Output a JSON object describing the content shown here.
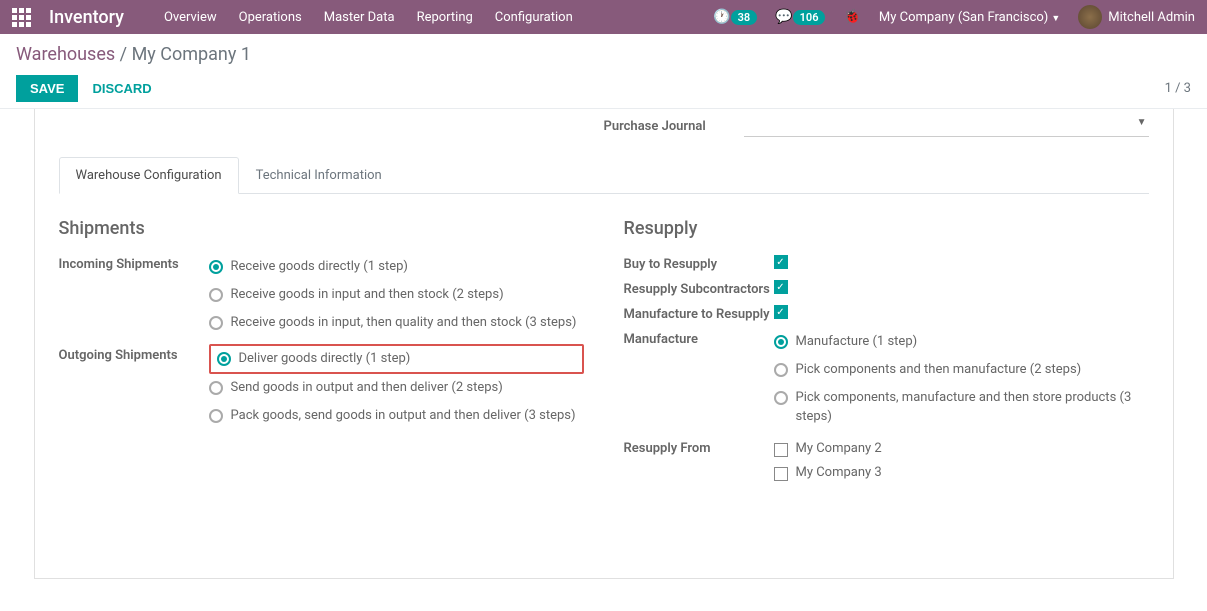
{
  "topbar": {
    "brand": "Inventory",
    "menu": [
      "Overview",
      "Operations",
      "Master Data",
      "Reporting",
      "Configuration"
    ],
    "badge1": "38",
    "badge2": "106",
    "company": "My Company (San Francisco)",
    "user": "Mitchell Admin"
  },
  "breadcrumb": {
    "root": "Warehouses",
    "current": "My Company 1"
  },
  "actions": {
    "save": "SAVE",
    "discard": "DISCARD"
  },
  "pager": "1 / 3",
  "fields": {
    "purchase_journal": "Purchase Journal"
  },
  "tabs": {
    "config": "Warehouse Configuration",
    "tech": "Technical Information"
  },
  "shipments": {
    "title": "Shipments",
    "incoming_label": "Incoming Shipments",
    "incoming": [
      "Receive goods directly (1 step)",
      "Receive goods in input and then stock (2 steps)",
      "Receive goods in input, then quality and then stock (3 steps)"
    ],
    "outgoing_label": "Outgoing Shipments",
    "outgoing": [
      "Deliver goods directly (1 step)",
      "Send goods in output and then deliver (2 steps)",
      "Pack goods, send goods in output and then deliver (3 steps)"
    ]
  },
  "resupply": {
    "title": "Resupply",
    "buy": "Buy to Resupply",
    "subcon": "Resupply Subcontractors",
    "mfg_to": "Manufacture to Resupply",
    "mfg_label": "Manufacture",
    "mfg": [
      "Manufacture (1 step)",
      "Pick components and then manufacture (2 steps)",
      "Pick components, manufacture and then store products (3 steps)"
    ],
    "from_label": "Resupply From",
    "from": [
      "My Company 2",
      "My Company 3"
    ]
  }
}
